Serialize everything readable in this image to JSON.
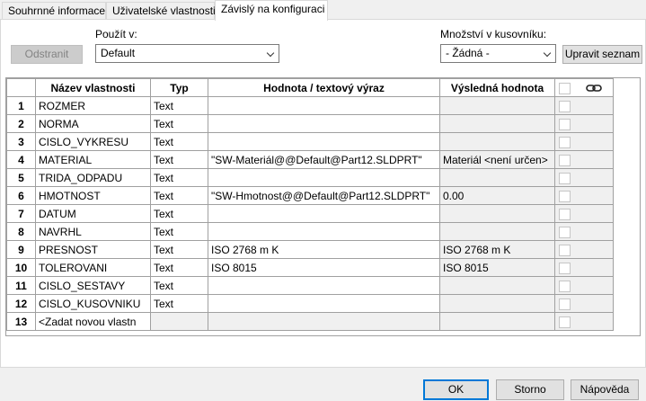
{
  "tabs": [
    {
      "label": "Souhrnné informace",
      "active": false
    },
    {
      "label": "Uživatelské vlastnosti",
      "active": false
    },
    {
      "label": "Závislý na konfiguraci",
      "active": true
    }
  ],
  "toolbar": {
    "delete_label": "Odstranit",
    "apply_to_label": "Použít v:",
    "apply_to_value": "Default",
    "bom_qty_label": "Množství v kusovníku:",
    "bom_qty_value": "- Žádná -",
    "edit_list_label": "Upravit seznam"
  },
  "grid": {
    "headers": {
      "name": "Název vlastnosti",
      "type": "Typ",
      "value": "Hodnota / textový výraz",
      "result": "Výsledná hodnota"
    },
    "rows": [
      {
        "num": "1",
        "name": "ROZMER",
        "type": "Text",
        "value": "",
        "result": ""
      },
      {
        "num": "2",
        "name": "NORMA",
        "type": "Text",
        "value": "",
        "result": ""
      },
      {
        "num": "3",
        "name": "CISLO_VYKRESU",
        "type": "Text",
        "value": "",
        "result": ""
      },
      {
        "num": "4",
        "name": "MATERIAL",
        "type": "Text",
        "value": "\"SW-Materiál@@Default@Part12.SLDPRT\"",
        "result": "Materiál <není určen>"
      },
      {
        "num": "5",
        "name": "TRIDA_ODPADU",
        "type": "Text",
        "value": "",
        "result": ""
      },
      {
        "num": "6",
        "name": "HMOTNOST",
        "type": "Text",
        "value": "\"SW-Hmotnost@@Default@Part12.SLDPRT\"",
        "result": "0.00"
      },
      {
        "num": "7",
        "name": "DATUM",
        "type": "Text",
        "value": "",
        "result": ""
      },
      {
        "num": "8",
        "name": "NAVRHL",
        "type": "Text",
        "value": "",
        "result": ""
      },
      {
        "num": "9",
        "name": "PRESNOST",
        "type": "Text",
        "value": "ISO 2768 m K",
        "result": "ISO 2768 m K"
      },
      {
        "num": "10",
        "name": "TOLEROVANI",
        "type": "Text",
        "value": "ISO 8015",
        "result": "ISO 8015"
      },
      {
        "num": "11",
        "name": "CISLO_SESTAVY",
        "type": "Text",
        "value": "",
        "result": ""
      },
      {
        "num": "12",
        "name": "CISLO_KUSOVNIKU",
        "type": "Text",
        "value": "",
        "result": ""
      },
      {
        "num": "13",
        "name": "<Zadat novou vlastn",
        "type": "",
        "value": "",
        "result": ""
      }
    ]
  },
  "footer": {
    "ok_label": "OK",
    "cancel_label": "Storno",
    "help_label": "Nápověda"
  },
  "icons": {
    "link": "chain-link-icon"
  },
  "colors": {
    "accent": "#0078d7",
    "cell_gray": "#f0f0f0"
  }
}
